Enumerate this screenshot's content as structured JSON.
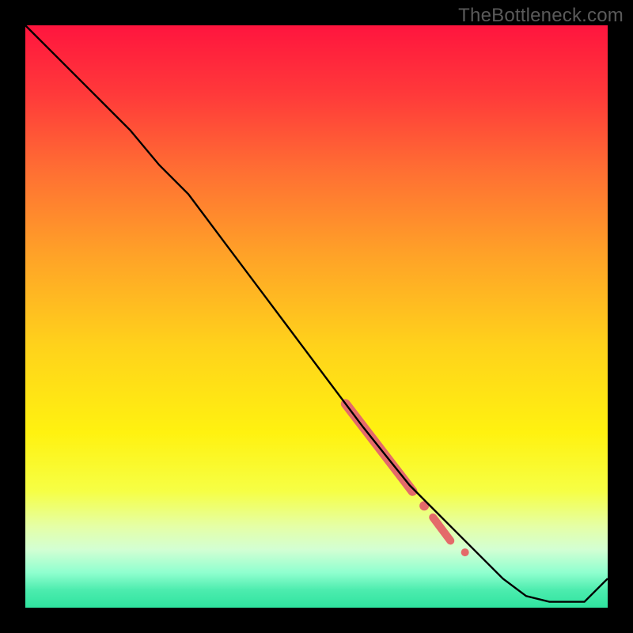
{
  "watermark": "TheBottleneck.com",
  "gradient": {
    "stops": [
      {
        "offset": 0.0,
        "color": "#ff153e"
      },
      {
        "offset": 0.12,
        "color": "#ff3a3a"
      },
      {
        "offset": 0.25,
        "color": "#ff6f33"
      },
      {
        "offset": 0.4,
        "color": "#ffa427"
      },
      {
        "offset": 0.55,
        "color": "#ffd21b"
      },
      {
        "offset": 0.7,
        "color": "#fff210"
      },
      {
        "offset": 0.8,
        "color": "#f6ff45"
      },
      {
        "offset": 0.86,
        "color": "#e5ffa6"
      },
      {
        "offset": 0.9,
        "color": "#d3ffd3"
      },
      {
        "offset": 0.94,
        "color": "#8fffcf"
      },
      {
        "offset": 0.97,
        "color": "#4cecae"
      },
      {
        "offset": 1.0,
        "color": "#2fe39f"
      }
    ]
  },
  "chart_data": {
    "type": "line",
    "title": "",
    "xlabel": "",
    "ylabel": "",
    "xlim": [
      0,
      100
    ],
    "ylim": [
      0,
      100
    ],
    "series": [
      {
        "name": "curve",
        "x": [
          0,
          6,
          12,
          18,
          23,
          28,
          34,
          40,
          46,
          52,
          58,
          62,
          66,
          70,
          74,
          78,
          82,
          86,
          90,
          96,
          100
        ],
        "y": [
          100,
          94,
          88,
          82,
          76,
          71,
          63,
          55,
          47,
          39,
          31,
          26,
          21,
          17,
          13,
          9,
          5,
          2,
          1,
          1,
          5
        ]
      }
    ],
    "highlights": [
      {
        "type": "thick_segment",
        "x0": 55,
        "x1": 66.5,
        "y0": 35,
        "y1": 20,
        "width": 12,
        "color": "#e46a6a"
      },
      {
        "type": "dot",
        "x": 68.5,
        "y": 17.5,
        "r": 6,
        "color": "#e46a6a"
      },
      {
        "type": "thick_segment",
        "x0": 70,
        "x1": 73,
        "y0": 15.5,
        "y1": 11.5,
        "width": 10,
        "color": "#e46a6a"
      },
      {
        "type": "dot",
        "x": 75.5,
        "y": 9.5,
        "r": 5,
        "color": "#e46a6a"
      }
    ]
  }
}
